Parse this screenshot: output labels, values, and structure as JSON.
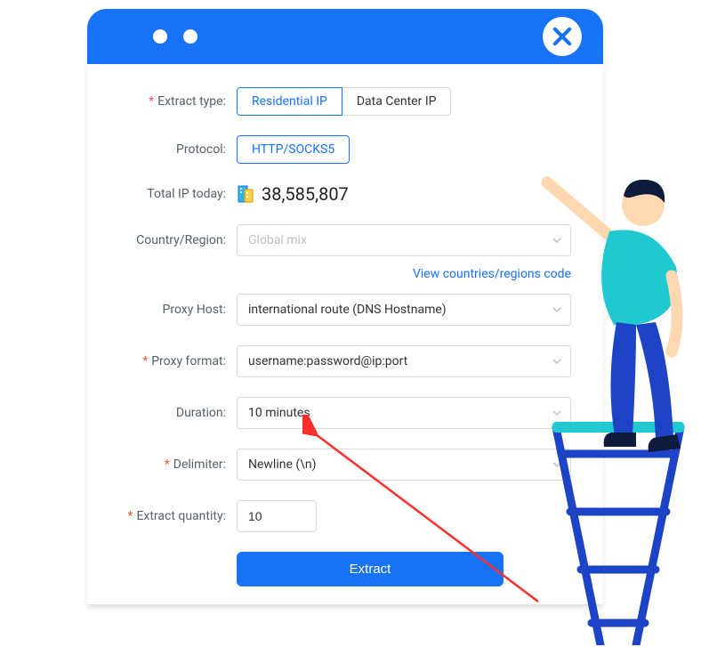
{
  "labels": {
    "extract_type": "Extract type:",
    "protocol": "Protocol:",
    "total_ip": "Total IP today:",
    "country": "Country/Region:",
    "proxy_host": "Proxy Host:",
    "proxy_format": "Proxy format:",
    "duration": "Duration:",
    "delimiter": "Delimiter:",
    "extract_quantity": "Extract quantity:"
  },
  "extract_type": {
    "options": [
      "Residential IP",
      "Data Center IP"
    ],
    "selected": "Residential IP"
  },
  "protocol": {
    "options": [
      "HTTP/SOCKS5"
    ],
    "selected": "HTTP/SOCKS5"
  },
  "total_ip_today": "38,585,807",
  "country": {
    "placeholder": "Global mix"
  },
  "country_link": "View countries/regions code",
  "proxy_host": {
    "value": "international route (DNS Hostname)"
  },
  "proxy_format": {
    "value": "username:password@ip:port"
  },
  "duration": {
    "value": "10 minutes"
  },
  "delimiter": {
    "value": "Newline (\\n)"
  },
  "extract_quantity": "10",
  "extract_button": "Extract"
}
